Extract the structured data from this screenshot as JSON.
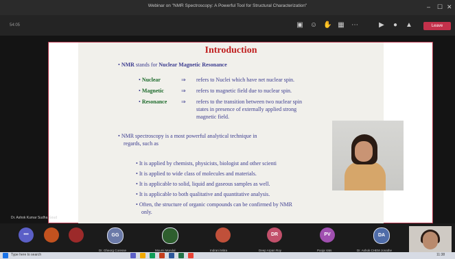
{
  "window": {
    "title": "Webinar on \"NMR Spectroscopy: A Powerful Tool for Structural Characterization\"",
    "controls": [
      "–",
      "☐",
      "✕"
    ]
  },
  "toolbar": {
    "timer": "54:05",
    "leave_label": "Leave",
    "icons": [
      "chat-icon",
      "reactions-icon",
      "raise-hand-icon",
      "apps-icon",
      "more-icon",
      "camera-icon",
      "mic-icon",
      "share-icon"
    ]
  },
  "slide": {
    "title": "Introduction",
    "intro_prefix": "NMR",
    "intro_mid": " stands for ",
    "intro_term": "Nuclear Magnetic Resonance",
    "defs": [
      {
        "term": "Nuclear",
        "arrow": "⇒",
        "text": "refers to Nuclei which have net nuclear spin."
      },
      {
        "term": "Magnetic",
        "arrow": "⇒",
        "text": "refers to magnetic field due to nuclear spin."
      },
      {
        "term": "Resonance",
        "arrow": "⇒",
        "text": "refers to the transition between two nuclear spin"
      }
    ],
    "def_cont1": "states in presence of externally applied strong",
    "def_cont2": "magnetic field.",
    "para_line1": "NMR spectroscopy is a most powerful analytical technique in",
    "para_line2": "regards, such as",
    "bullets": [
      "It is applied by chemists, physicists, biologist and other scienti",
      "It is applied to wide class of molecules and materials.",
      "It is applicable to solid, liquid and gaseous samples as well.",
      "It is applicable to both qualitative and quantitative analysis.",
      "Often, the structure of organic compounds can be confirmed by NMR"
    ],
    "last_cont": "only."
  },
  "presenter_label": "Dr. Ashok Kumar Sudha Goud",
  "participants": [
    {
      "initials": "•••",
      "color": "#5b5fc7",
      "label": ""
    },
    {
      "initials": "",
      "color": "#c2521f",
      "label": ""
    },
    {
      "initials": "",
      "color": "#9c2a2a",
      "label": ""
    },
    {
      "initials": "GG",
      "color": "#6b7aa8",
      "label": "Dr. Gheorg Coresse"
    },
    {
      "initials": "",
      "color": "#2e5e2e",
      "label": "Moumi Mondal"
    },
    {
      "initials": "",
      "color": "#c0503a",
      "label": "Indrani Mitra"
    },
    {
      "initials": "DR",
      "color": "#c2506b",
      "label": "Deep Arpan Roy"
    },
    {
      "initials": "PV",
      "color": "#a04fb0",
      "label": "Pooja Vats"
    },
    {
      "initials": "DA",
      "color": "#4f6ca8",
      "label": "Dr. Ashok CHEM Jonathe"
    }
  ],
  "taskbar": {
    "search_text": "Type here to search",
    "time": "11:38"
  }
}
